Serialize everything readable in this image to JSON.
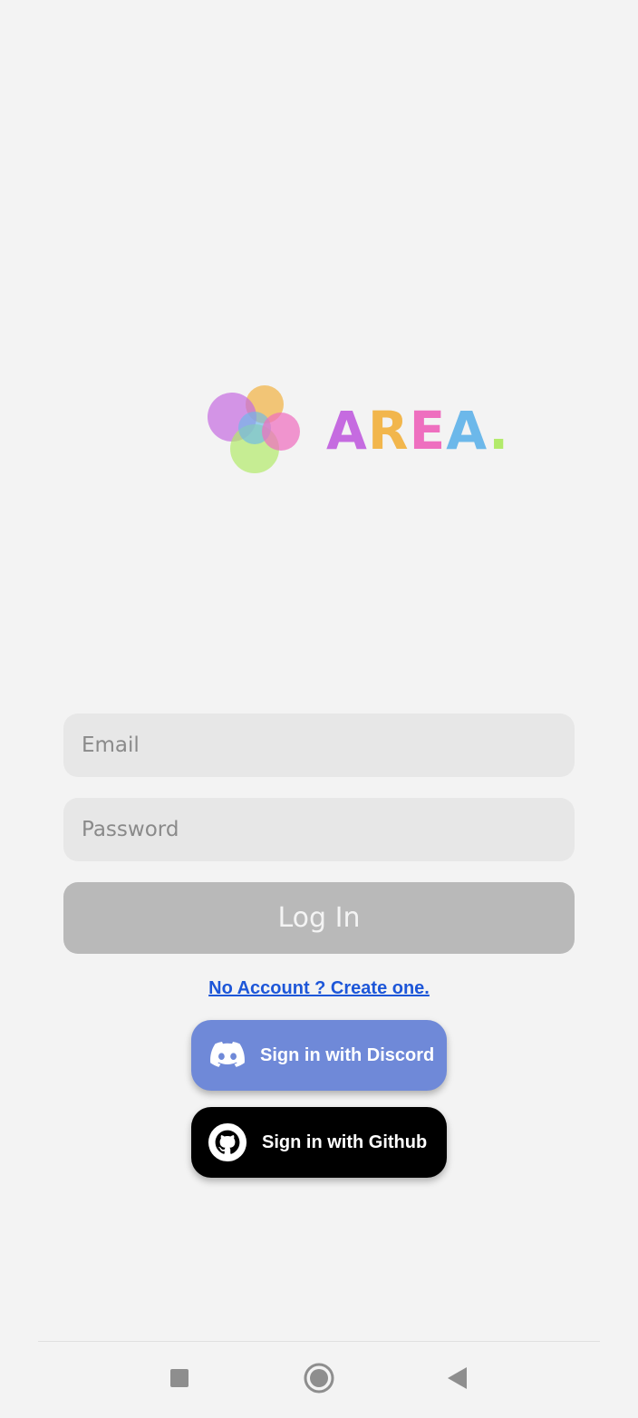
{
  "logo": {
    "letters": [
      "A",
      "R",
      "E",
      "A",
      "."
    ],
    "colors": [
      "#c56be0",
      "#f2b64c",
      "#ee6fbf",
      "#6cb8ea",
      "#b2ea6a"
    ]
  },
  "form": {
    "email_placeholder": "Email",
    "email_value": "",
    "password_placeholder": "Password",
    "password_value": "",
    "login_label": "Log In"
  },
  "links": {
    "create_account": "No Account ? Create one."
  },
  "oauth": {
    "discord_label": "Sign in with Discord",
    "discord_icon": "discord-icon",
    "discord_color": "#6f89d8",
    "github_label": "Sign in with Github",
    "github_icon": "github-icon",
    "github_color": "#000000"
  },
  "navbar": {
    "recent_icon": "square-icon",
    "home_icon": "circle-icon",
    "back_icon": "triangle-back-icon"
  }
}
